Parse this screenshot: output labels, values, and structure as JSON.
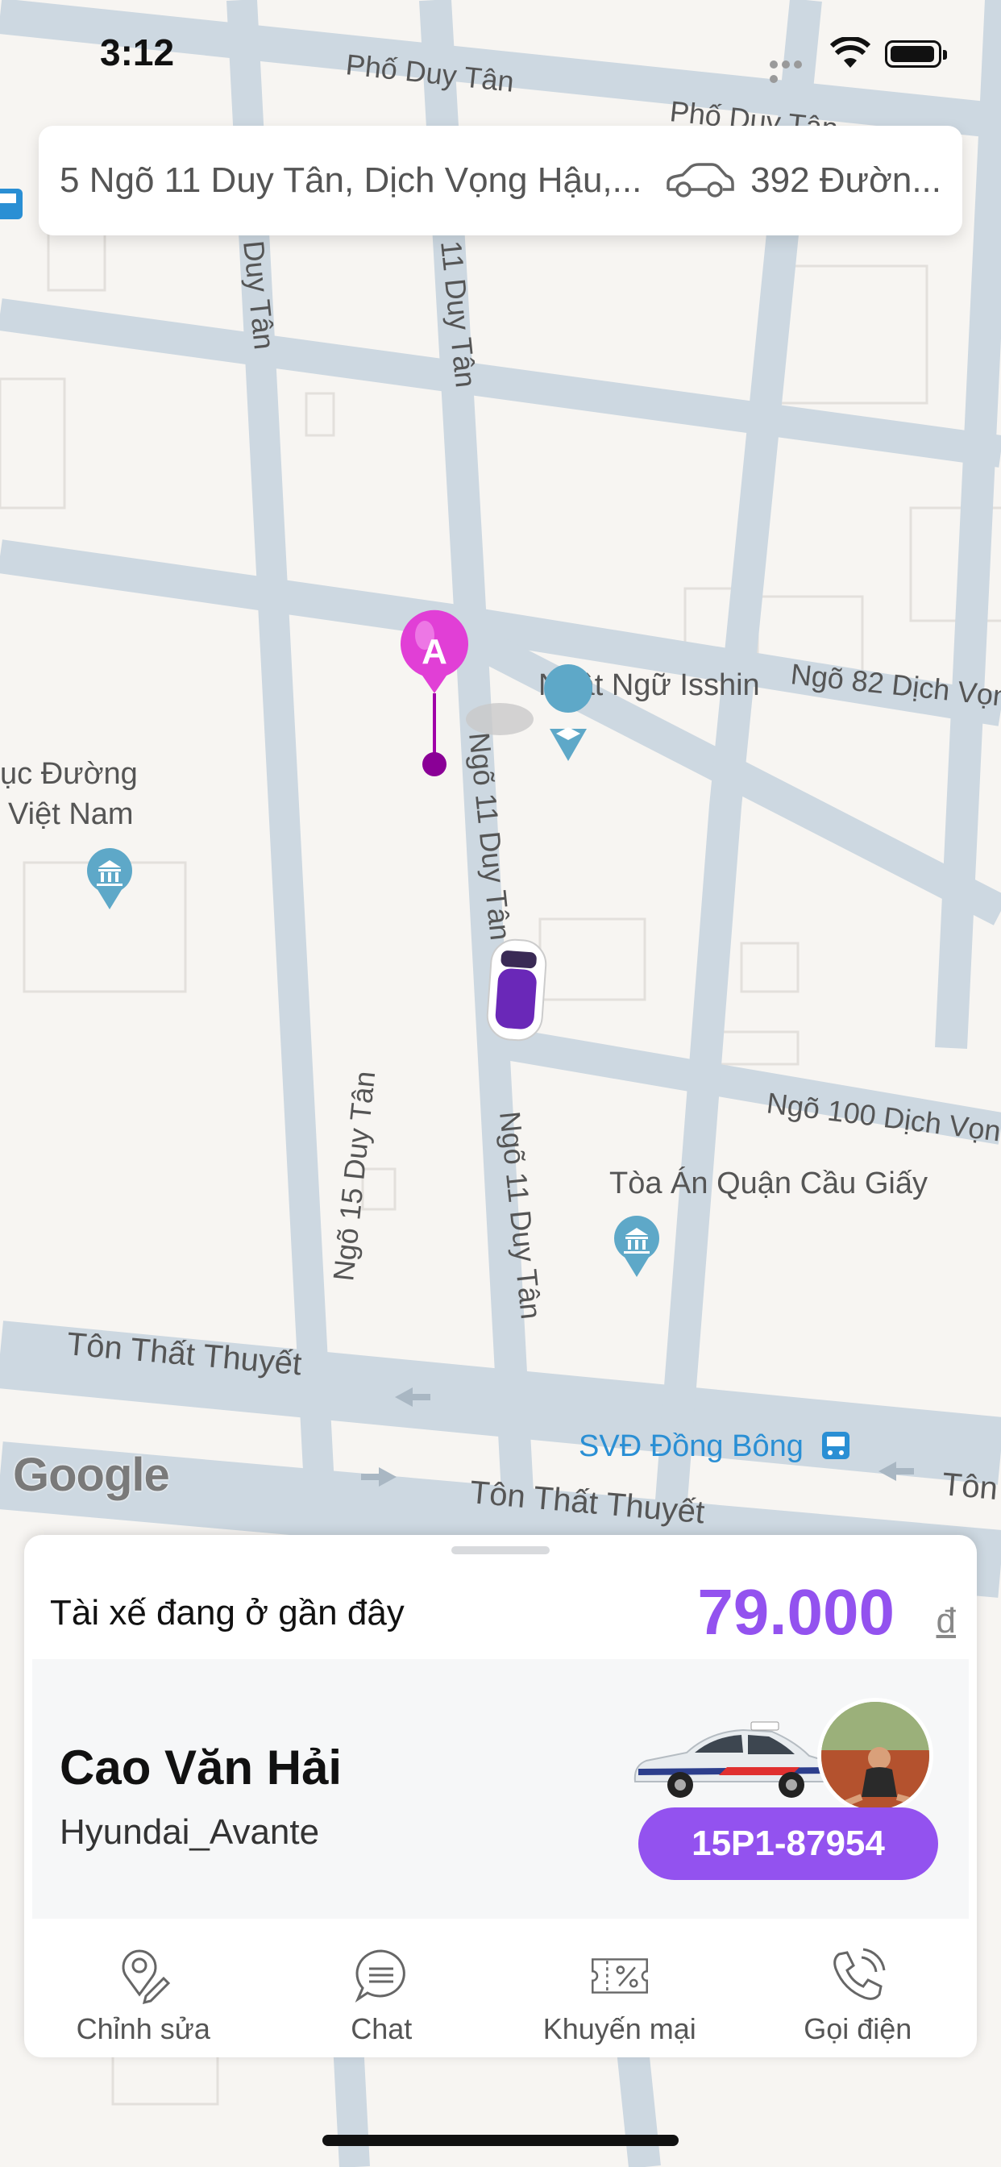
{
  "status_bar": {
    "time": "3:12"
  },
  "route": {
    "from": "5 Ngõ 11 Duy Tân, Dịch Vọng Hậu,...",
    "to": "392 Đườn...",
    "car_icon": "car-outline-icon"
  },
  "map": {
    "street_labels": [
      "Phố Duy Tân",
      "Phố Duy Tân",
      "Duy Tân",
      "11 Duy Tân",
      "Ngõ 11 Duy Tân",
      "Ngõ 11 Duy Tân",
      "Ngõ 15 Duy Tân",
      "Ngõ 82 Dịch Vọng",
      "Ngõ 100 Dịch Vọng",
      "Tôn Thất Thuyết",
      "Tôn Thất Thuyết",
      "Tôn"
    ],
    "pois": [
      {
        "name": "Nhật Ngữ Isshin",
        "icon": "school-pin-icon"
      },
      {
        "name": "ục Đường",
        "icon": "museum-pin-icon"
      },
      {
        "name": "Việt Nam",
        "icon": "museum-pin-icon"
      },
      {
        "name": "Tòa Án Quận Cầu Giấy",
        "icon": "museum-pin-icon"
      },
      {
        "name": "SVĐ Đồng Bông",
        "icon": "bus-stop-icon"
      }
    ],
    "pickup_marker_label": "A",
    "attribution": "Google"
  },
  "sheet": {
    "nearby_text": "Tài xế đang ở gần đây",
    "price": "79.000",
    "currency": "đ",
    "driver": {
      "name": "Cao Văn Hải",
      "car_model": "Hyundai_Avante",
      "plate": "15P1-87954"
    },
    "actions": [
      {
        "label": "Chỉnh sửa",
        "icon": "edit-pin-icon"
      },
      {
        "label": "Chat",
        "icon": "chat-bubble-icon"
      },
      {
        "label": "Khuyến mại",
        "icon": "promo-ticket-icon"
      },
      {
        "label": "Gọi điện",
        "icon": "phone-call-icon"
      }
    ]
  },
  "colors": {
    "accent": "#9352ef",
    "pin": "#e13fd6",
    "road": "#c9d6e0",
    "poi_pin": "#5ea8c8"
  }
}
